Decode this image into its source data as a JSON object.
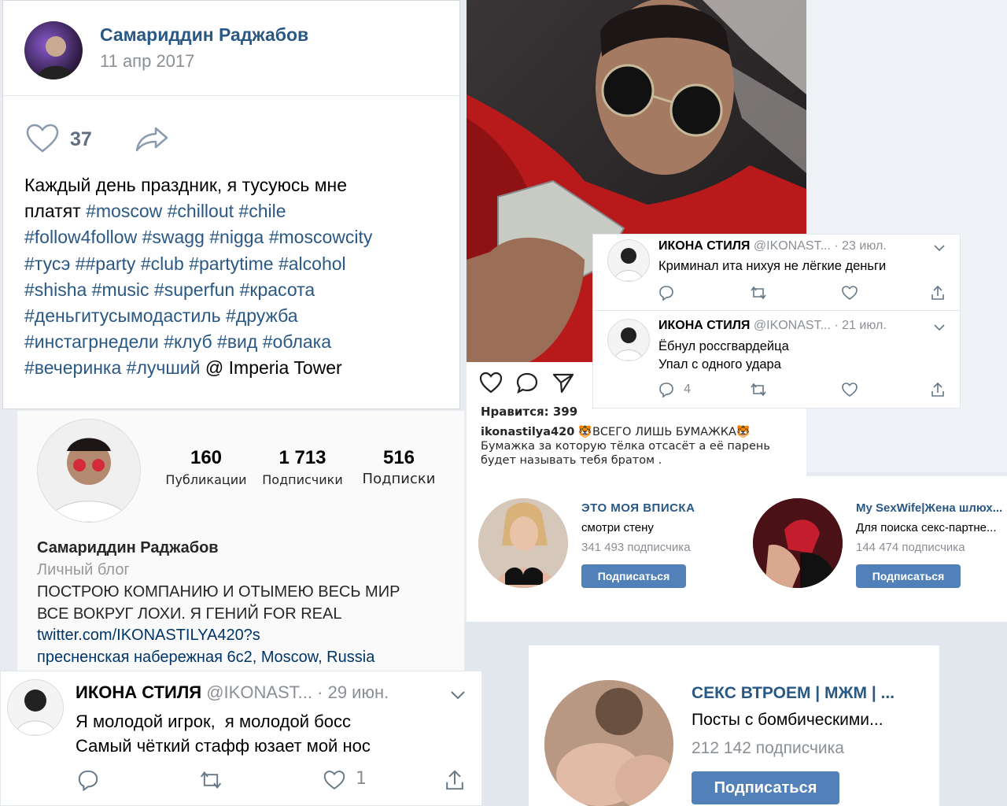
{
  "vk_post": {
    "author": "Самариддин Раджабов",
    "date": "11 апр 2017",
    "likes": "37",
    "text_lines": [
      "Каждый день праздник, я тусуюсь мне",
      "платят #moscow #chillout #chile",
      "#follow4follow #swagg #nigga #moscowcity",
      "#тусэ ##party #club #partytime #alcohol",
      "#shisha #music #superfun #красота",
      "#деньгитусымодастиль #дружба",
      "#инстагрнедели #клуб #вид #облака",
      "#вечеринка #лучший @ Imperia Tower"
    ]
  },
  "insta_post": {
    "likes": "Нравится: 399",
    "username": "ikonastilya420",
    "caption_title": "🐯ВСЕГО ЛИШЬ БУМАЖКА🐯",
    "caption_line1": "Бумажка за которую тёлка отсасёт а её парень",
    "caption_line2": "будет называть тебя братом ."
  },
  "tweets_top": [
    {
      "name": "ИКОНА СТИЛЯ",
      "handle": "@IKONAST...",
      "date": "· 23 июл.",
      "line1": "Криминал ита нихуя не лёгкие деньги",
      "line2": "",
      "replies": "",
      "likes": ""
    },
    {
      "name": "ИКОНА СТИЛЯ",
      "handle": "@IKONAST...",
      "date": "· 21 июл.",
      "line1": "Ёбнул россгвардейца",
      "line2": "Упал с одного удара",
      "replies": "4",
      "likes": ""
    }
  ],
  "insta_profile": {
    "posts_count": "160",
    "posts_label": "Публикации",
    "followers_count": "1 713",
    "followers_label": "Подписчики",
    "following_count": "516",
    "following_label": "Подписки",
    "name": "Самариддин Раджабов",
    "category": "Личный блог",
    "bio_line1": "ПОСТРОЮ КОМПАНИЮ И ОТЫМЕЮ ВЕСЬ МИР",
    "bio_line2": "ВСЕ ВОКРУГ ЛОХИ. Я ГЕНИЙ FOR REAL",
    "link": "twitter.com/IKONASTILYA420?s",
    "location": "пресненская набережная 6с2, Moscow, Russia"
  },
  "vk_groups": [
    {
      "title": "ЭТО МОЯ ВПИСКА",
      "desc": "смотри стену",
      "subs": "341 493 подписчика",
      "button": "Подписаться"
    },
    {
      "title": "My SexWife|Жена шлюх...",
      "desc": "Для поиска секс-партне...",
      "subs": "144 474 подписчика",
      "button": "Подписаться"
    }
  ],
  "tweet_bottom": {
    "name": "ИКОНА СТИЛЯ",
    "handle": "@IKONAST...",
    "date": "· 29 июн.",
    "line1": "Я молодой игрок,  я молодой босс",
    "line2": "Самый чёткий стафф юзает мой нос",
    "likes": "1"
  },
  "vk_group_big": {
    "title": "СЕКС ВТРОЕМ | МЖМ | ...",
    "desc": "Посты с бомбическими...",
    "subs": "212 142 подписчика",
    "button": "Подписаться"
  },
  "colors": {
    "vk_blue": "#5181b8",
    "link_blue": "#2a5885",
    "hoodie_red": "#b8191b"
  }
}
